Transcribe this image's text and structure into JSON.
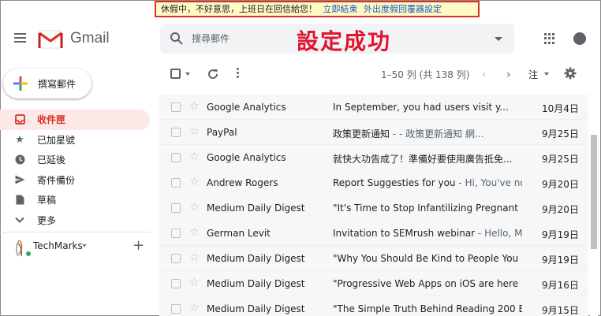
{
  "banner": {
    "message": "休假中，不好意思，上班日在回信給您！",
    "end_link": "立即結束",
    "settings_link": "外出度假回覆器設定"
  },
  "header": {
    "brand": "Gmail",
    "search_placeholder": "搜尋郵件",
    "overlay_title": "設定成功"
  },
  "compose": {
    "label": "撰寫郵件"
  },
  "sidebar": {
    "items": [
      {
        "label": "收件匣",
        "icon": "inbox-icon",
        "active": true
      },
      {
        "label": "已加星號",
        "icon": "star-icon",
        "active": false
      },
      {
        "label": "已延後",
        "icon": "clock-icon",
        "active": false
      },
      {
        "label": "寄件備份",
        "icon": "send-icon",
        "active": false
      },
      {
        "label": "草稿",
        "icon": "draft-icon",
        "active": false
      },
      {
        "label": "更多",
        "icon": "chevron-down-icon",
        "active": false
      }
    ],
    "account_name": "TechMarks"
  },
  "toolbar": {
    "pager": "1–50 列 (共 138 列)",
    "language": "注"
  },
  "emails": [
    {
      "sender": "Google Analytics",
      "subject": "In September, you had  users visit y...",
      "snippet": "",
      "date": "10月4日",
      "read": true
    },
    {
      "sender": "PayPal",
      "subject": "政策更新通知",
      "snippet": " - - 政策更新通知 網...",
      "date": "9月25日",
      "read": true
    },
    {
      "sender": "Google Analytics",
      "subject": "就快大功告成了！準備好要使用廣告抵免...",
      "snippet": "",
      "date": "9月25日",
      "read": true
    },
    {
      "sender": "Andrew Rogers",
      "subject": "Report Suggesties for you",
      "snippet": " - Hi, You've not...",
      "date": "9月20日",
      "read": true
    },
    {
      "sender": "Medium Daily Digest",
      "subject": "\"It's Time to Stop Infantilizing Pregnant",
      "snippet": "",
      "date": "9月20日",
      "read": true
    },
    {
      "sender": "German Levit",
      "subject": "Invitation to SEMrush webinar",
      "snippet": " - Hello, My...",
      "date": "9月19日",
      "read": true
    },
    {
      "sender": "Medium Daily Digest",
      "subject": "\"Why You Should Be Kind to People You",
      "snippet": "",
      "date": "9月19日",
      "read": true
    },
    {
      "sender": "Medium Daily Digest",
      "subject": "\"Progressive Web Apps on iOS are here",
      "snippet": "",
      "date": "9月16日",
      "read": true
    },
    {
      "sender": "Medium Daily Digest",
      "subject": "\"The Simple Truth Behind Reading 200 B",
      "snippet": "",
      "date": "9月15日",
      "read": true
    }
  ],
  "colors": {
    "accent": "#d93025",
    "overlay": "#e0152e",
    "banner_bg": "#fff9c4",
    "link": "#1a57c9"
  }
}
